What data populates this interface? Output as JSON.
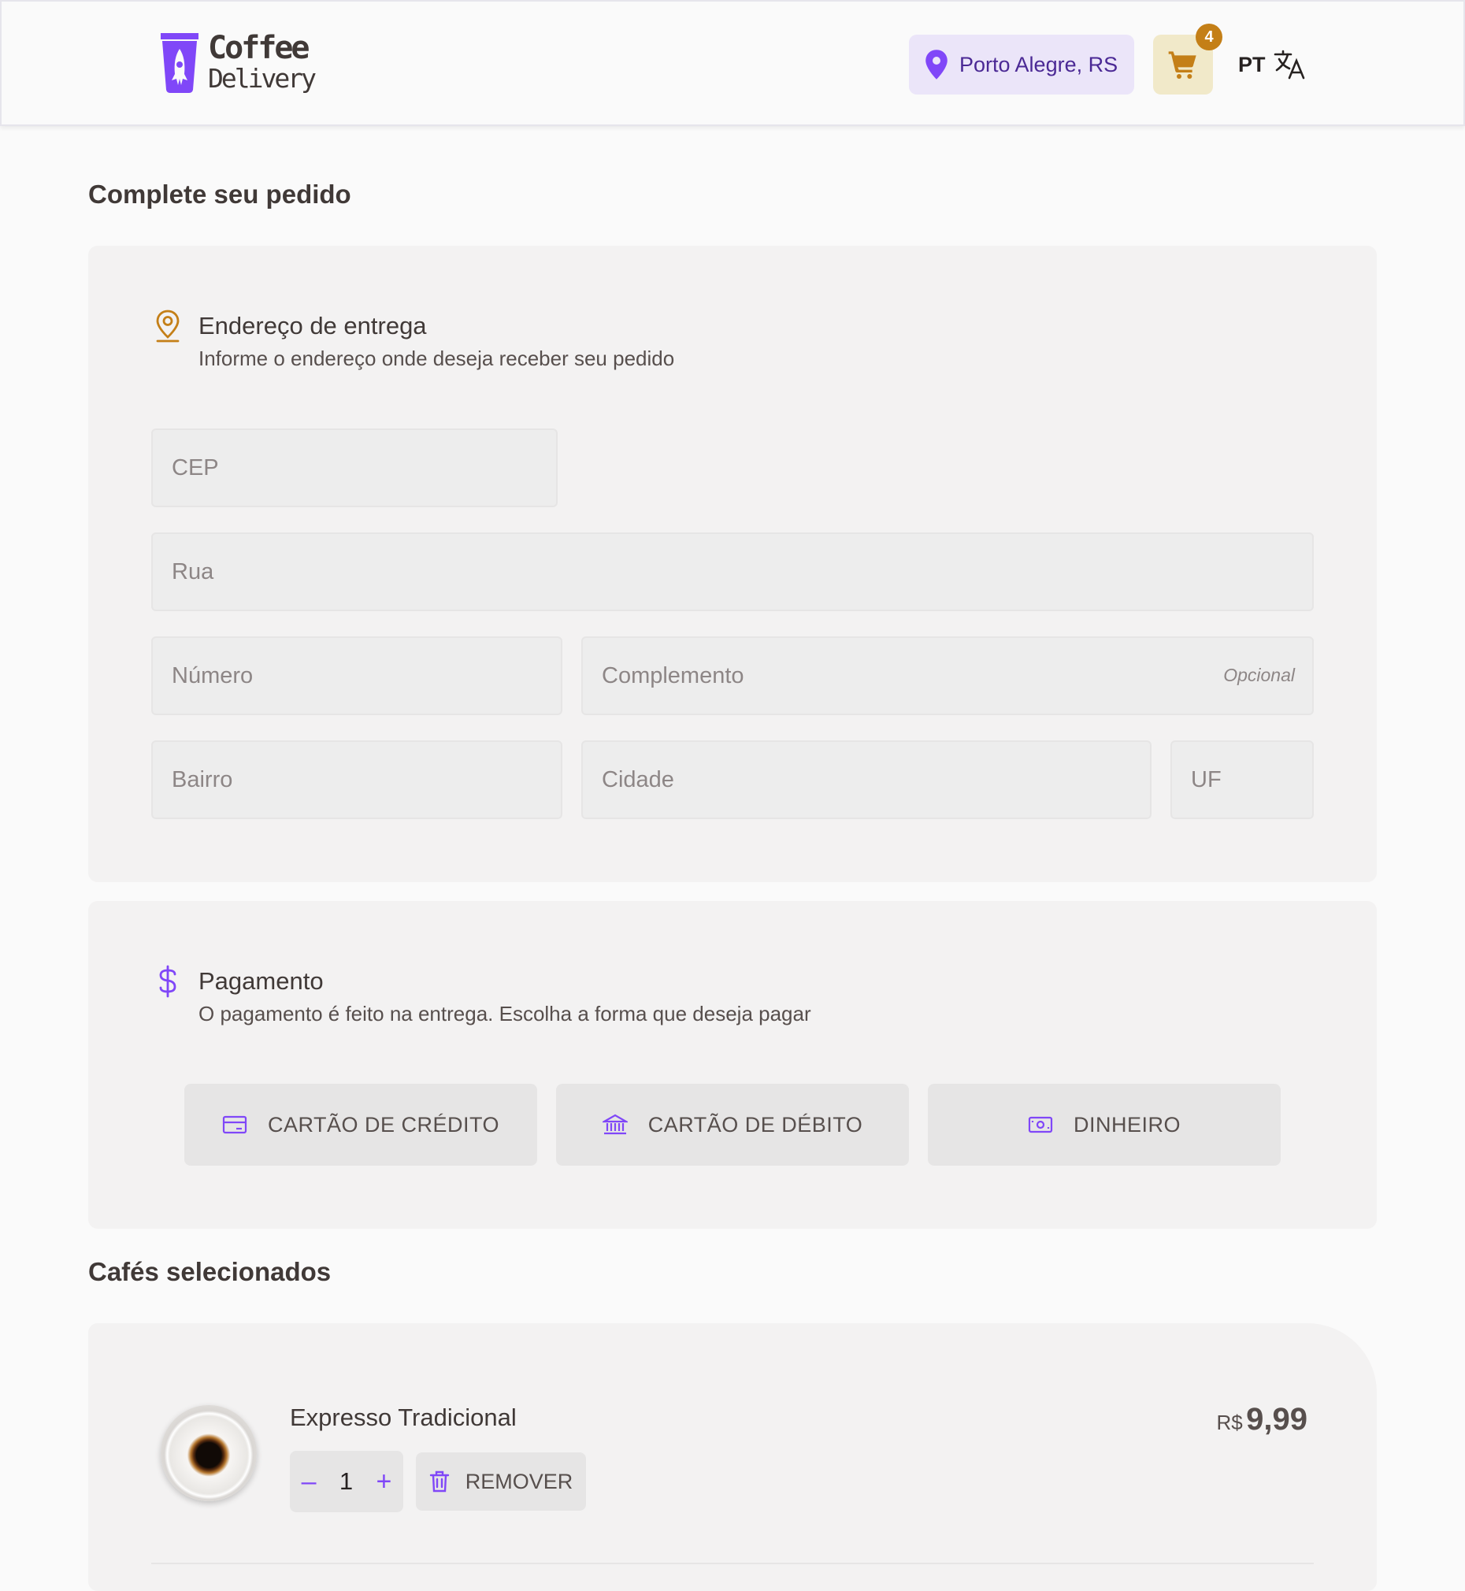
{
  "header": {
    "logo_line1": "Coffee",
    "logo_line2": "Delivery",
    "location": "Porto Alegre, RS",
    "cart_count": "4",
    "language": "PT"
  },
  "checkout": {
    "title": "Complete seu pedido",
    "address": {
      "title": "Endereço de entrega",
      "subtitle": "Informe o endereço onde deseja receber seu pedido",
      "cep_placeholder": "CEP",
      "street_placeholder": "Rua",
      "number_placeholder": "Número",
      "complement_placeholder": "Complemento",
      "complement_optional": "Opcional",
      "district_placeholder": "Bairro",
      "city_placeholder": "Cidade",
      "state_placeholder": "UF"
    },
    "payment": {
      "title": "Pagamento",
      "subtitle": "O pagamento é feito na entrega. Escolha a forma que deseja pagar",
      "credit": "CARTÃO DE CRÉDITO",
      "debit": "CARTÃO DE DÉBITO",
      "cash": "DINHEIRO"
    }
  },
  "cart": {
    "title": "Cafés selecionados",
    "items": [
      {
        "name": "Expresso Tradicional",
        "quantity": "1",
        "remove_label": "REMOVER",
        "currency": "R$",
        "price": "9,99"
      }
    ]
  },
  "colors": {
    "purple": "#8047f8",
    "purple_dark": "#4b2995",
    "yellow_dark": "#c47f17",
    "yellow_light": "#f1e9c9",
    "purple_light": "#ebe5f9"
  }
}
